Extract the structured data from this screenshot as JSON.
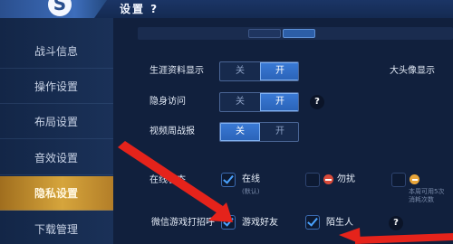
{
  "header": {
    "logo_char": "S",
    "title": "设置 ?"
  },
  "sidebar": {
    "items": [
      {
        "label": "战斗信息"
      },
      {
        "label": "操作设置"
      },
      {
        "label": "布局设置"
      },
      {
        "label": "音效设置"
      },
      {
        "label": "隐私设置",
        "active": true
      },
      {
        "label": "下载管理"
      }
    ]
  },
  "settings": {
    "career": {
      "label": "生涯资料显示",
      "off": "关",
      "on": "开",
      "state": "on",
      "extra_label": "大头像显示"
    },
    "invisible": {
      "label": "隐身访问",
      "off": "关",
      "on": "开",
      "state": "on",
      "help": "?"
    },
    "video": {
      "label": "视频周战报",
      "off": "关",
      "on": "开",
      "state": "off"
    },
    "online": {
      "label": "在线状态",
      "options": [
        {
          "label": "在线",
          "sub": "(默认)",
          "checked": true
        },
        {
          "label": "勿扰",
          "checked": false
        },
        {
          "label": "",
          "sub_line1": "本周可用5次",
          "sub_line2": "消耗次数",
          "checked": false
        }
      ]
    },
    "wechat": {
      "label": "微信游戏打招呼",
      "options": [
        {
          "label": "游戏好友",
          "checked": true
        },
        {
          "label": "陌生人",
          "checked": true
        }
      ],
      "help": "?"
    }
  },
  "colors": {
    "accent": "#2a63b8",
    "active_nav": "#d6a53c",
    "arrow": "#e5231b",
    "check": "#4aa3ff"
  }
}
